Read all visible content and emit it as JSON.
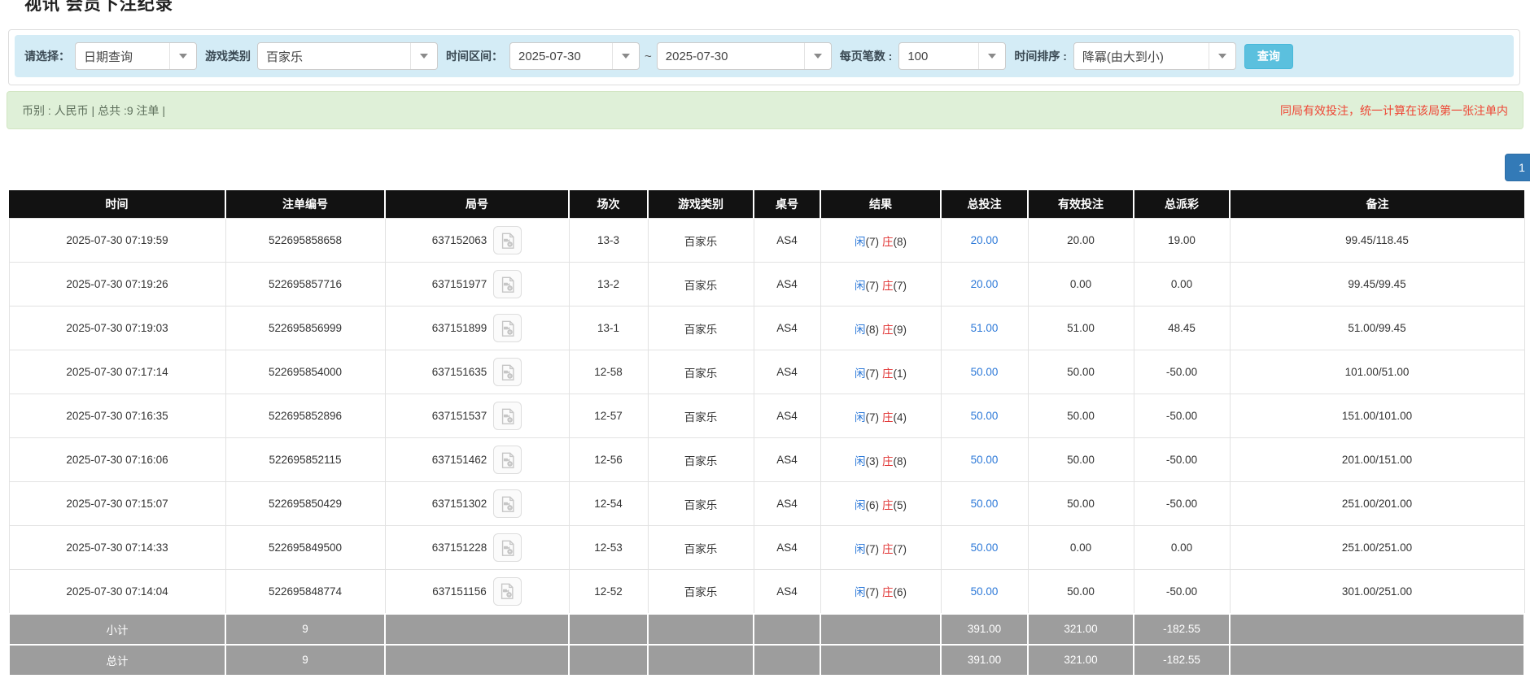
{
  "page": {
    "title": "视讯 会员下注纪录"
  },
  "filters": {
    "select_label": "请选择：",
    "select_value": "日期查询",
    "game_type_label": "游戏类别",
    "game_type_value": "百家乐",
    "time_range_label": "时间区间：",
    "date_from": "2025-07-30",
    "date_separator": "~",
    "date_to": "2025-07-30",
    "page_size_label": "每页笔数 :",
    "page_size_value": "100",
    "sort_label": "时间排序 :",
    "sort_value": "降冪(由大到小)",
    "query_button": "查询"
  },
  "summary": {
    "info": "币别 : 人民币 | 总共 :9 注单 |",
    "notice": "同局有效投注，统一计算在该局第一张注单内"
  },
  "pagination": {
    "current_page": "1"
  },
  "table": {
    "headers": {
      "time": "时间",
      "bet_id": "注单编号",
      "round_id": "局号",
      "session": "场次",
      "game": "游戏类别",
      "table_no": "桌号",
      "result": "结果",
      "total_bet": "总投注",
      "valid_bet": "有效投注",
      "payout": "总派彩",
      "remark": "备注"
    },
    "rows": [
      {
        "time": "2025-07-30 07:19:59",
        "bet_id": "522695858658",
        "round_id": "637152063",
        "session": "13-3",
        "game": "百家乐",
        "table_no": "AS4",
        "result": {
          "player_label": "闲",
          "player_score": "(7)",
          "banker_label": "庄",
          "banker_score": "(8)"
        },
        "total_bet": "20.00",
        "valid_bet": "20.00",
        "payout": "19.00",
        "remark": "99.45/118.45"
      },
      {
        "time": "2025-07-30 07:19:26",
        "bet_id": "522695857716",
        "round_id": "637151977",
        "session": "13-2",
        "game": "百家乐",
        "table_no": "AS4",
        "result": {
          "player_label": "闲",
          "player_score": "(7)",
          "banker_label": "庄",
          "banker_score": "(7)"
        },
        "total_bet": "20.00",
        "valid_bet": "0.00",
        "payout": "0.00",
        "remark": "99.45/99.45"
      },
      {
        "time": "2025-07-30 07:19:03",
        "bet_id": "522695856999",
        "round_id": "637151899",
        "session": "13-1",
        "game": "百家乐",
        "table_no": "AS4",
        "result": {
          "player_label": "闲",
          "player_score": "(8)",
          "banker_label": "庄",
          "banker_score": "(9)"
        },
        "total_bet": "51.00",
        "valid_bet": "51.00",
        "payout": "48.45",
        "remark": "51.00/99.45"
      },
      {
        "time": "2025-07-30 07:17:14",
        "bet_id": "522695854000",
        "round_id": "637151635",
        "session": "12-58",
        "game": "百家乐",
        "table_no": "AS4",
        "result": {
          "player_label": "闲",
          "player_score": "(7)",
          "banker_label": "庄",
          "banker_score": "(1)"
        },
        "total_bet": "50.00",
        "valid_bet": "50.00",
        "payout": "-50.00",
        "remark": "101.00/51.00"
      },
      {
        "time": "2025-07-30 07:16:35",
        "bet_id": "522695852896",
        "round_id": "637151537",
        "session": "12-57",
        "game": "百家乐",
        "table_no": "AS4",
        "result": {
          "player_label": "闲",
          "player_score": "(7)",
          "banker_label": "庄",
          "banker_score": "(4)"
        },
        "total_bet": "50.00",
        "valid_bet": "50.00",
        "payout": "-50.00",
        "remark": "151.00/101.00"
      },
      {
        "time": "2025-07-30 07:16:06",
        "bet_id": "522695852115",
        "round_id": "637151462",
        "session": "12-56",
        "game": "百家乐",
        "table_no": "AS4",
        "result": {
          "player_label": "闲",
          "player_score": "(3)",
          "banker_label": "庄",
          "banker_score": "(8)"
        },
        "total_bet": "50.00",
        "valid_bet": "50.00",
        "payout": "-50.00",
        "remark": "201.00/151.00"
      },
      {
        "time": "2025-07-30 07:15:07",
        "bet_id": "522695850429",
        "round_id": "637151302",
        "session": "12-54",
        "game": "百家乐",
        "table_no": "AS4",
        "result": {
          "player_label": "闲",
          "player_score": "(6)",
          "banker_label": "庄",
          "banker_score": "(5)"
        },
        "total_bet": "50.00",
        "valid_bet": "50.00",
        "payout": "-50.00",
        "remark": "251.00/201.00"
      },
      {
        "time": "2025-07-30 07:14:33",
        "bet_id": "522695849500",
        "round_id": "637151228",
        "session": "12-53",
        "game": "百家乐",
        "table_no": "AS4",
        "result": {
          "player_label": "闲",
          "player_score": "(7)",
          "banker_label": "庄",
          "banker_score": "(7)"
        },
        "total_bet": "50.00",
        "valid_bet": "0.00",
        "payout": "0.00",
        "remark": "251.00/251.00"
      },
      {
        "time": "2025-07-30 07:14:04",
        "bet_id": "522695848774",
        "round_id": "637151156",
        "session": "12-52",
        "game": "百家乐",
        "table_no": "AS4",
        "result": {
          "player_label": "闲",
          "player_score": "(7)",
          "banker_label": "庄",
          "banker_score": "(6)"
        },
        "total_bet": "50.00",
        "valid_bet": "50.00",
        "payout": "-50.00",
        "remark": "301.00/251.00"
      }
    ],
    "subtotal": {
      "label": "小计",
      "count": "9",
      "total_bet": "391.00",
      "valid_bet": "321.00",
      "payout": "-182.55"
    },
    "total": {
      "label": "总计",
      "count": "9",
      "total_bet": "391.00",
      "valid_bet": "321.00",
      "payout": "-182.55"
    }
  },
  "colors": {
    "filter_bar_bg": "#d4ecf6",
    "summary_bar_bg": "#dff0d8",
    "notice_red": "#ee4634",
    "query_button": "#5bc0de",
    "pagination_blue": "#337ab7",
    "header_black": "#121212",
    "link_blue": "#2d79d8",
    "banker_red": "#e03131",
    "negative_red": "#e60000",
    "highlight_yellow": "#f8f88e",
    "totals_gray": "#9d9d9d"
  }
}
